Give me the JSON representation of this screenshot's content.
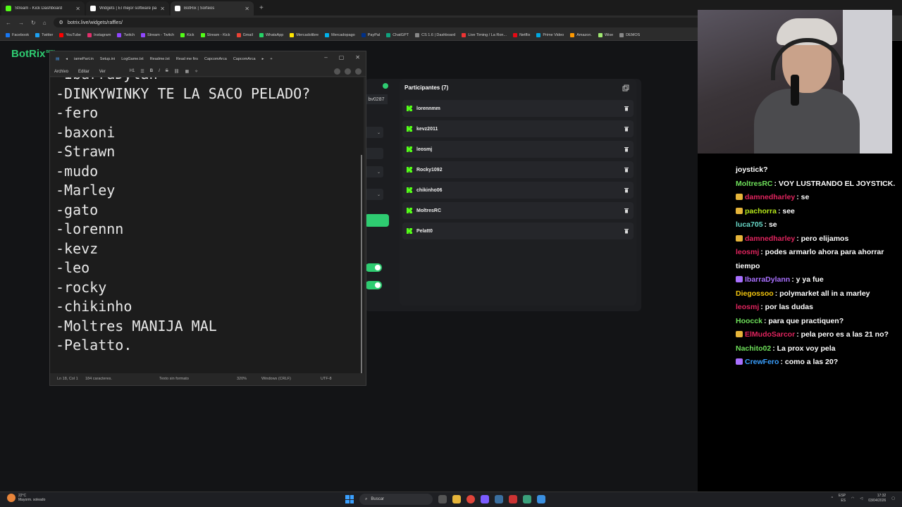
{
  "browser": {
    "tabs": [
      {
        "title": "Stream - Kick Dashboard",
        "color": "#53fc18"
      },
      {
        "title": "Widgets | El mejor software pa",
        "color": "#ffffff"
      },
      {
        "title": "BotRix | Sorteos",
        "color": "#ffffff"
      }
    ],
    "url": "botrix.live/widgets/raffles/",
    "bookmarks": [
      "Facebook",
      "Twitter",
      "YouTube",
      "Instagram",
      "Twitch",
      "Stream - Twitch",
      "Kick",
      "Stream - Kick",
      "Gmail",
      "WhatsApp",
      "Mercadolibre",
      "Mercadopago",
      "PayPal",
      "ChatGPT",
      "CS 1.6 | Dashboard",
      "Live Timing / La Ron...",
      "Netflix",
      "Prime Video",
      "Amazon.",
      "Wise",
      "DEMOS"
    ]
  },
  "app": {
    "logo": "BotRix",
    "logo_badge": "BETA",
    "tag_text": "bv0287",
    "participants_title": "Participantes (7)",
    "participants": [
      "lorennmm",
      "kevz2011",
      "leosmj",
      "Rocky1092",
      "chikinho06",
      "MoltresRC",
      "Pelatt0"
    ]
  },
  "notepad": {
    "tabs": [
      "iamePart.in",
      "Setup.ini",
      "LogGame.txt",
      "Readme.txt",
      "Read me firs",
      "CapcomArca",
      "CapcomArca"
    ],
    "menu": [
      "Archivo",
      "Editar",
      "Ver"
    ],
    "heading_tool": "H1",
    "lines": [
      "-IbarraDylan",
      "-DINKYWINKY TE LA SACO PELADO?",
      "-fero",
      "-baxoni",
      "-Strawn",
      "-mudo",
      "-Marley",
      "-gato",
      "-lorennn",
      "-kevz",
      "-leo",
      "-rocky",
      "-chikinho",
      "-Moltres MANIJA MAL",
      "-Pelatto."
    ],
    "status": {
      "position": "Ln 18, Col 1",
      "chars": "184 caracteres.",
      "format": "Texto sin formato",
      "zoom": "320%",
      "eol": "Windows (CRLF)",
      "encoding": "UTF-8"
    }
  },
  "chat": {
    "messages": [
      {
        "user": "",
        "text": "joystick?",
        "color": "#ffffff"
      },
      {
        "user": "MoltresRC",
        "text": ": VOY LUSTRANDO EL JOYSTICK.",
        "color": "#6ee05a"
      },
      {
        "user": "damnedharley",
        "text": ": se",
        "color": "#e0245e"
      },
      {
        "user": "pachorra",
        "text": ": see",
        "color": "#b6e81a"
      },
      {
        "user": "luca705",
        "text": ": se",
        "color": "#67d6c6"
      },
      {
        "user": "damnedharley",
        "text": ": pero elijamos",
        "color": "#e0245e"
      },
      {
        "user": "leosmj",
        "text": ": podes armarlo ahora para ahorrar tiempo",
        "color": "#e0245e"
      },
      {
        "user": "IbarraDylann",
        "text": ": y ya fue",
        "color": "#a970ff"
      },
      {
        "user": "Diegossoo",
        "text": ": polymarket all in a marley",
        "color": "#f1c40f"
      },
      {
        "user": "leosmj",
        "text": ": por las dudas",
        "color": "#e0245e"
      },
      {
        "user": "Hoocck",
        "text": ": para que practiquen?",
        "color": "#6ee05a"
      },
      {
        "user": "ElMudoSarcor",
        "text": ": pela pero es a las 21 no?",
        "color": "#e0245e"
      },
      {
        "user": "Nachito02",
        "text": ": La prox voy pela",
        "color": "#6ee05a"
      },
      {
        "user": "CrewFero",
        "text": ": como a las 20?",
        "color": "#3aa0ff"
      }
    ]
  },
  "taskbar": {
    "weather_temp": "22°C",
    "weather_desc": "Mayorm. soleado",
    "search": "Buscar",
    "lang": "ESP",
    "lang2": "ES",
    "time": "17:32",
    "date": "03/04/2026"
  }
}
